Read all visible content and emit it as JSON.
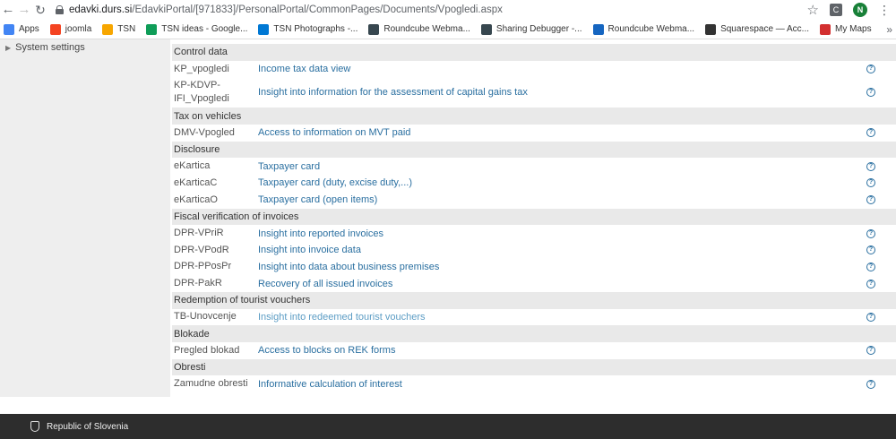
{
  "browser": {
    "url_host": "edavki.durs.si",
    "url_path": "/EdavkiPortal/[971833]/PersonalPortal/CommonPages/Documents/Vpogledi.aspx",
    "extension_label": "C",
    "profile_initial": "N",
    "bookmarks": [
      {
        "label": "Apps",
        "icon": "apps-grid-icon",
        "color": "#4285f4"
      },
      {
        "label": "joomla",
        "icon": "joomla-icon",
        "color": "#f44321"
      },
      {
        "label": "TSN",
        "icon": "tsn-icon",
        "color": "#f7a600"
      },
      {
        "label": "TSN ideas - Google...",
        "icon": "sheets-icon",
        "color": "#0f9d58"
      },
      {
        "label": "TSN Photographs -...",
        "icon": "onedrive-icon",
        "color": "#0078d4"
      },
      {
        "label": "Roundcube Webma...",
        "icon": "roundcube-icon",
        "color": "#37474f"
      },
      {
        "label": "Sharing Debugger -...",
        "icon": "facebook-debug-icon",
        "color": "#37474f"
      },
      {
        "label": "Roundcube Webma...",
        "icon": "roundcube-icon",
        "color": "#1565c0"
      },
      {
        "label": "Squarespace — Acc...",
        "icon": "squarespace-icon",
        "color": "#333333"
      },
      {
        "label": "My Maps",
        "icon": "my-maps-icon",
        "color": "#d32f2f"
      }
    ]
  },
  "sidebar": {
    "item_label": "System settings"
  },
  "content": {
    "rows": [
      {
        "type": "section",
        "title": "Control data"
      },
      {
        "type": "item",
        "code": "KP_vpogledi",
        "label": "Income tax data view"
      },
      {
        "type": "item",
        "code": "KP-KDVP-IFI_Vpogledi",
        "label": "Insight into information for the assessment of capital gains tax",
        "tall": true
      },
      {
        "type": "section",
        "title": "Tax on vehicles"
      },
      {
        "type": "item",
        "code": "DMV-Vpogled",
        "label": "Access to information on MVT paid"
      },
      {
        "type": "section",
        "title": "Disclosure"
      },
      {
        "type": "item",
        "code": "eKartica",
        "label": "Taxpayer card"
      },
      {
        "type": "item",
        "code": "eKarticaC",
        "label": "Taxpayer card (duty, excise duty,...)"
      },
      {
        "type": "item",
        "code": "eKarticaO",
        "label": "Taxpayer card (open items)"
      },
      {
        "type": "section",
        "title": "Fiscal verification of invoices"
      },
      {
        "type": "item",
        "code": "DPR-VPriR",
        "label": "Insight into reported invoices"
      },
      {
        "type": "item",
        "code": "DPR-VPodR",
        "label": "Insight into invoice data"
      },
      {
        "type": "item",
        "code": "DPR-PPosPr",
        "label": "Insight into data about business premises"
      },
      {
        "type": "item",
        "code": "DPR-PakR",
        "label": "Recovery of all issued invoices"
      },
      {
        "type": "section",
        "title": "Redemption of tourist vouchers"
      },
      {
        "type": "item",
        "code": "TB-Unovcenje",
        "label": "Insight into redeemed tourist vouchers",
        "muted": true
      },
      {
        "type": "section",
        "title": "Blokade"
      },
      {
        "type": "item",
        "code": "Pregled blokad",
        "label": "Access to blocks on REK forms"
      },
      {
        "type": "section",
        "title": "Obresti"
      },
      {
        "type": "item",
        "code": "Zamudne obresti",
        "label": "Informative calculation of interest"
      }
    ]
  },
  "footer": {
    "text": "Republic of Slovenia"
  }
}
